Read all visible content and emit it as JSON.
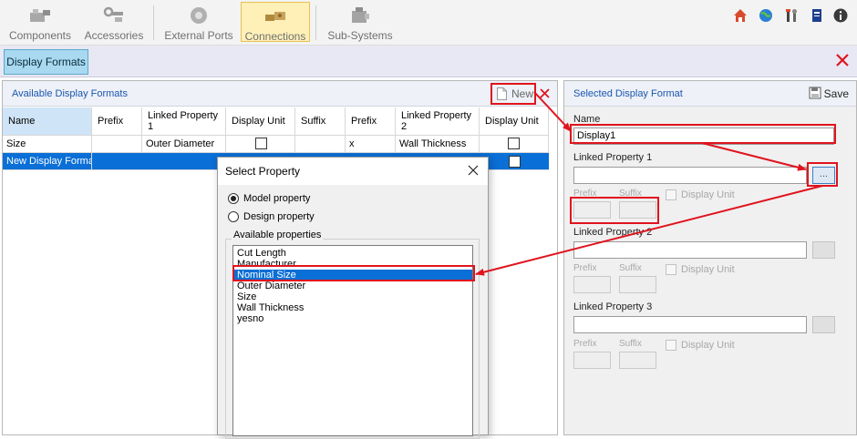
{
  "toolbar": {
    "buttons": [
      {
        "label": "Components",
        "icon": "components-icon",
        "active": false
      },
      {
        "label": "Accessories",
        "icon": "accessories-icon",
        "active": false
      },
      {
        "label": "External Ports",
        "icon": "external-ports-icon",
        "active": false
      },
      {
        "label": "Connections",
        "icon": "connections-icon",
        "active": true
      },
      {
        "label": "Sub-Systems",
        "icon": "sub-systems-icon",
        "active": false
      }
    ],
    "right_icons": [
      "home-icon",
      "globe-icon",
      "tools-icon",
      "book-icon",
      "info-icon"
    ]
  },
  "tabs": {
    "display_formats": "Display Formats"
  },
  "left": {
    "title": "Available Display Formats",
    "new_label": "New",
    "columns": [
      "Name",
      "Prefix",
      "Linked Property 1",
      "Display Unit",
      "Suffix",
      "Prefix",
      "Linked Property 2",
      "Display Unit"
    ],
    "rows": [
      {
        "name": "Size",
        "prefix1": "",
        "lp1": "Outer Diameter",
        "du1": false,
        "suffix": "",
        "prefix2": "x",
        "lp2": "Wall Thickness",
        "du2": false
      },
      {
        "name": "New Display Format",
        "prefix1": "",
        "lp1": "",
        "du1": false,
        "suffix": "",
        "prefix2": "",
        "lp2": "",
        "du2": false
      }
    ]
  },
  "right": {
    "title": "Selected Display Format",
    "save_label": "Save",
    "name_label": "Name",
    "name_value": "Display1",
    "lp1_label": "Linked Property 1",
    "lp2_label": "Linked Property 2",
    "lp3_label": "Linked Property 3",
    "prefix_label": "Prefix",
    "suffix_label": "Suffix",
    "display_unit_label": "Display Unit",
    "browse_label": "..."
  },
  "dialog": {
    "title": "Select Property",
    "model_property": "Model property",
    "design_property": "Design property",
    "available_label": "Available properties",
    "items": [
      "Cut Length",
      "Manufacturer",
      "Nominal Size",
      "Outer Diameter",
      "Size",
      "Wall Thickness",
      "yesno"
    ],
    "selected_index": 2
  },
  "colors": {
    "accent": "#0a6fd6",
    "annotation": "#e0141e",
    "title_blue": "#1a56b0"
  }
}
